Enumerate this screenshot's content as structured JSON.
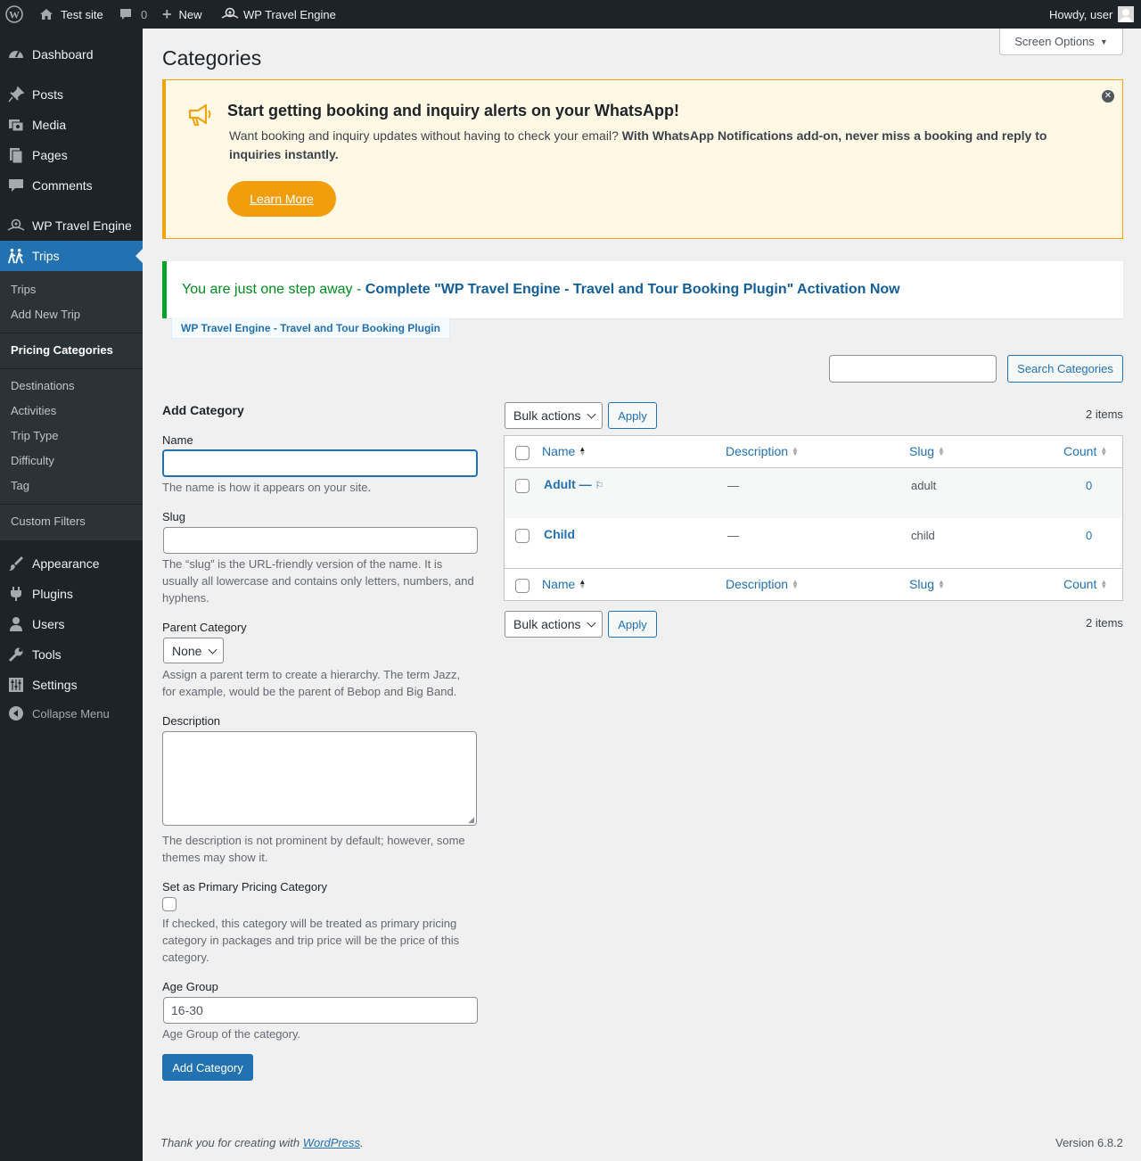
{
  "admin_bar": {
    "site_name": "Test site",
    "comments_count": "0",
    "new_label": "New",
    "plugin_label": "WP Travel Engine",
    "greeting": "Howdy, user"
  },
  "sidebar": {
    "dashboard": "Dashboard",
    "posts": "Posts",
    "media": "Media",
    "pages": "Pages",
    "comments": "Comments",
    "wp_travel_engine": "WP Travel Engine",
    "trips": "Trips",
    "submenu": {
      "trips": "Trips",
      "add_new_trip": "Add New Trip",
      "pricing_categories": "Pricing Categories",
      "destinations": "Destinations",
      "activities": "Activities",
      "trip_type": "Trip Type",
      "difficulty": "Difficulty",
      "tag": "Tag",
      "custom_filters": "Custom Filters"
    },
    "appearance": "Appearance",
    "plugins": "Plugins",
    "users": "Users",
    "tools": "Tools",
    "settings": "Settings",
    "collapse_menu": "Collapse Menu"
  },
  "screen_options": "Screen Options",
  "page_title": "Categories",
  "whatsapp_notice": {
    "title": "Start getting booking and inquiry alerts on your WhatsApp!",
    "text_plain": "Want booking and inquiry updates without having to check your email? ",
    "text_bold": "With WhatsApp Notifications add-on, never miss a booking and reply to inquiries instantly.",
    "button": "Learn More",
    "accent_color": "#f0a30a"
  },
  "activation_notice": {
    "prefix": "You are just one step away - ",
    "link": "Complete \"WP Travel Engine - Travel and Tour Booking Plugin\" Activation Now",
    "tag": "WP Travel Engine - Travel and Tour Booking Plugin"
  },
  "search": {
    "value": "",
    "button": "Search Categories"
  },
  "form": {
    "heading": "Add Category",
    "name_label": "Name",
    "name_value": "",
    "name_help": "The name is how it appears on your site.",
    "slug_label": "Slug",
    "slug_value": "",
    "slug_help": "The “slug” is the URL-friendly version of the name. It is usually all lowercase and contains only letters, numbers, and hyphens.",
    "parent_label": "Parent Category",
    "parent_value": "None",
    "parent_help": "Assign a parent term to create a hierarchy. The term Jazz, for example, would be the parent of Bebop and Big Band.",
    "description_label": "Description",
    "description_help": "The description is not prominent by default; however, some themes may show it.",
    "primary_label": "Set as Primary Pricing Category",
    "primary_checked": false,
    "primary_help": "If checked, this category will be treated as primary pricing category in packages and trip price will be the price of this category.",
    "age_label": "Age Group",
    "age_value": "16-30",
    "age_help": "Age Group of the category.",
    "submit": "Add Category"
  },
  "table": {
    "bulk_actions": "Bulk actions",
    "apply": "Apply",
    "items_count": "2 items",
    "columns": {
      "name": "Name",
      "description": "Description",
      "slug": "Slug",
      "count": "Count"
    },
    "rows": [
      {
        "name": "Adult — ",
        "primary_mark": "⚐",
        "description": "—",
        "slug": "adult",
        "count": "0"
      },
      {
        "name": "Child",
        "description": "—",
        "slug": "child",
        "count": "0"
      }
    ]
  },
  "footer": {
    "thanks_prefix": "Thank you for creating with ",
    "thanks_link": "WordPress",
    "thanks_suffix": ".",
    "version": "Version 6.8.2"
  }
}
